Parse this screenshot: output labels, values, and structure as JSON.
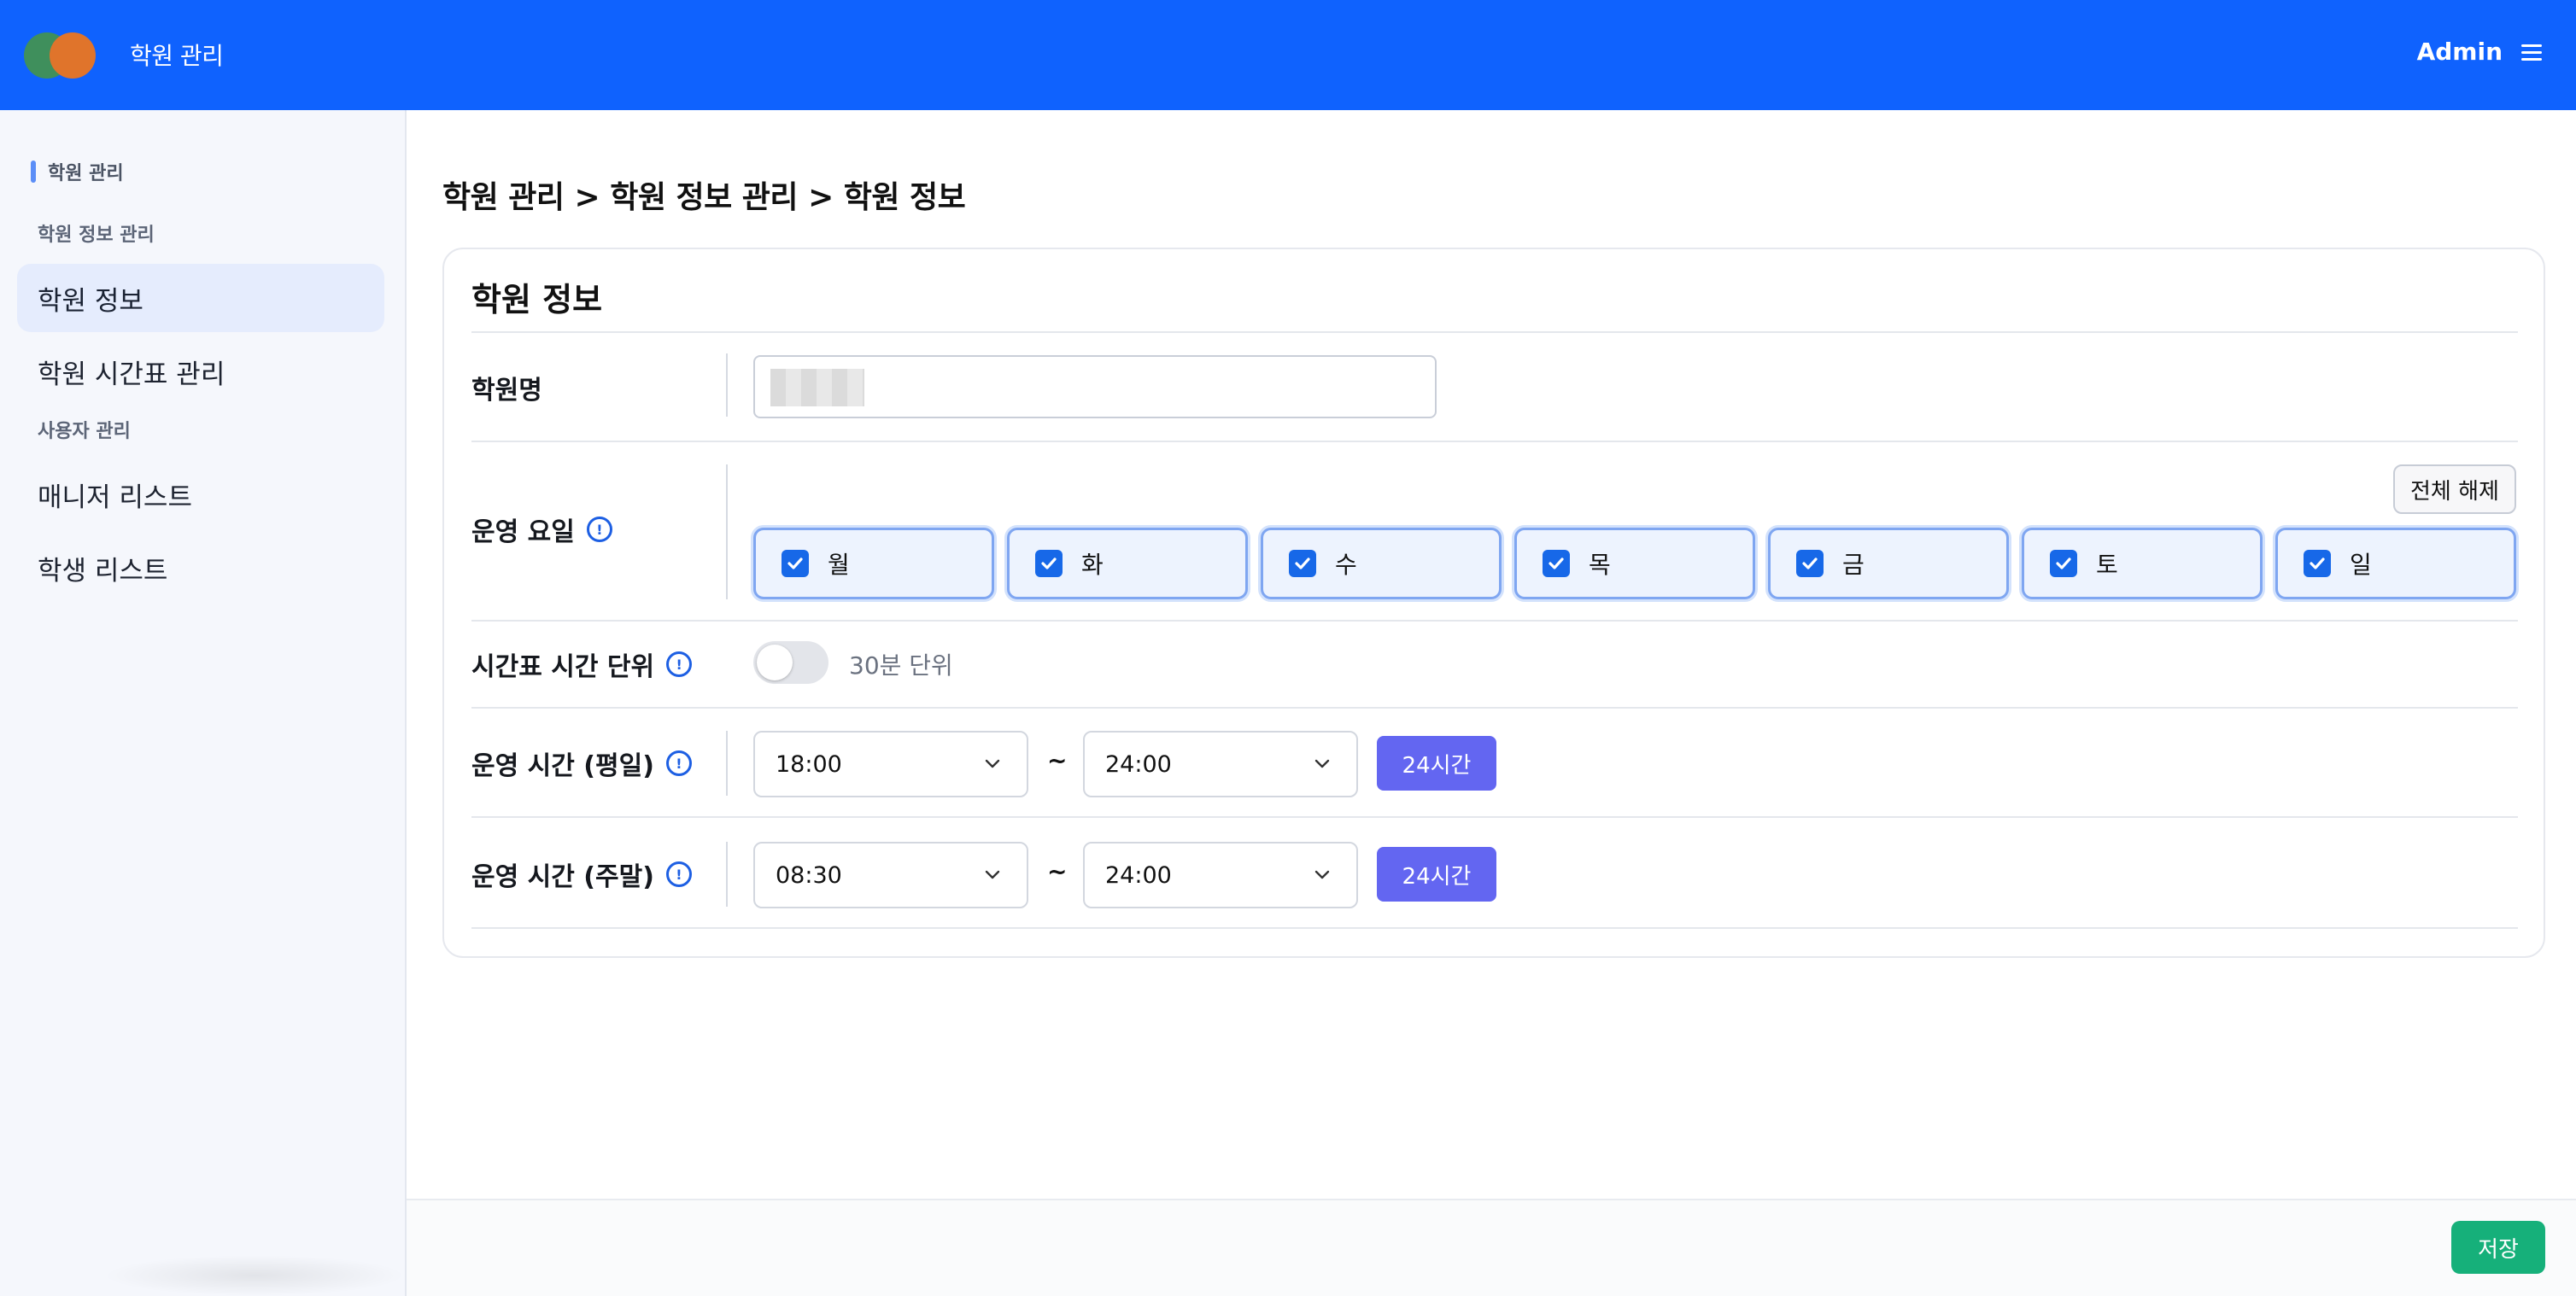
{
  "header": {
    "app_title": "학원 관리",
    "user": "Admin",
    "brand_color": "#0f62fe"
  },
  "sidebar": {
    "root_label": "학원 관리",
    "groups": [
      {
        "label": "학원 정보 관리",
        "items": [
          {
            "label": "학원 정보",
            "active": true
          },
          {
            "label": "학원 시간표 관리",
            "active": false
          }
        ]
      },
      {
        "label": "사용자 관리",
        "items": [
          {
            "label": "매니저 리스트",
            "active": false
          },
          {
            "label": "학생 리스트",
            "active": false
          }
        ]
      }
    ]
  },
  "breadcrumb": "학원 관리 > 학원 정보 관리 > 학원 정보",
  "form": {
    "title": "학원 정보",
    "academy_name": {
      "label": "학원명",
      "value": ""
    },
    "operating_days": {
      "label": "운영 요일",
      "clear_all_label": "전체 해제",
      "days": [
        {
          "label": "월",
          "checked": true
        },
        {
          "label": "화",
          "checked": true
        },
        {
          "label": "수",
          "checked": true
        },
        {
          "label": "목",
          "checked": true
        },
        {
          "label": "금",
          "checked": true
        },
        {
          "label": "토",
          "checked": true
        },
        {
          "label": "일",
          "checked": true
        }
      ]
    },
    "time_unit": {
      "label": "시간표 시간 단위",
      "toggle_on": false,
      "toggle_text": "30분 단위"
    },
    "weekday_hours": {
      "label": "운영 시간 (평일)",
      "start": "18:00",
      "end": "24:00",
      "button": "24시간"
    },
    "weekend_hours": {
      "label": "운영 시간 (주말)",
      "start": "08:30",
      "end": "24:00",
      "button": "24시간"
    },
    "range_separator": "~"
  },
  "footer": {
    "save_label": "저장",
    "save_color": "#16b07a"
  },
  "accent_color": "#6366f1"
}
